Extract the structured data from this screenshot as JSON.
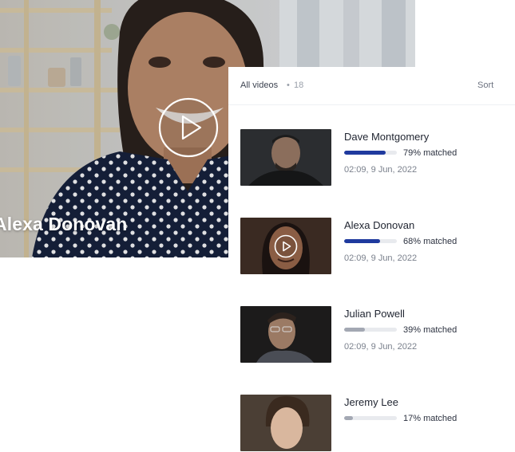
{
  "hero": {
    "name": "Alexa Donovan",
    "play_icon": "play-circle-icon"
  },
  "list": {
    "title": "All videos",
    "separator": "•",
    "count": "18",
    "sort_label": "Sort"
  },
  "videos": [
    {
      "name": "Dave Montgomery",
      "match_label": "79% matched",
      "match_fraction": 0.79,
      "meta": "02:09, 9 Jun, 2022",
      "bar_color": "#1f3a9e"
    },
    {
      "name": "Alexa Donovan",
      "match_label": "68% matched",
      "match_fraction": 0.68,
      "meta": "02:09, 9 Jun, 2022",
      "bar_color": "#1f3a9e"
    },
    {
      "name": "Julian Powell",
      "match_label": "39% matched",
      "match_fraction": 0.39,
      "meta": "02:09, 9 Jun, 2022",
      "bar_color": "#a3a8b3"
    },
    {
      "name": "Jeremy Lee",
      "match_label": "17% matched",
      "match_fraction": 0.17,
      "meta": "",
      "bar_color": "#a3a8b3"
    }
  ]
}
